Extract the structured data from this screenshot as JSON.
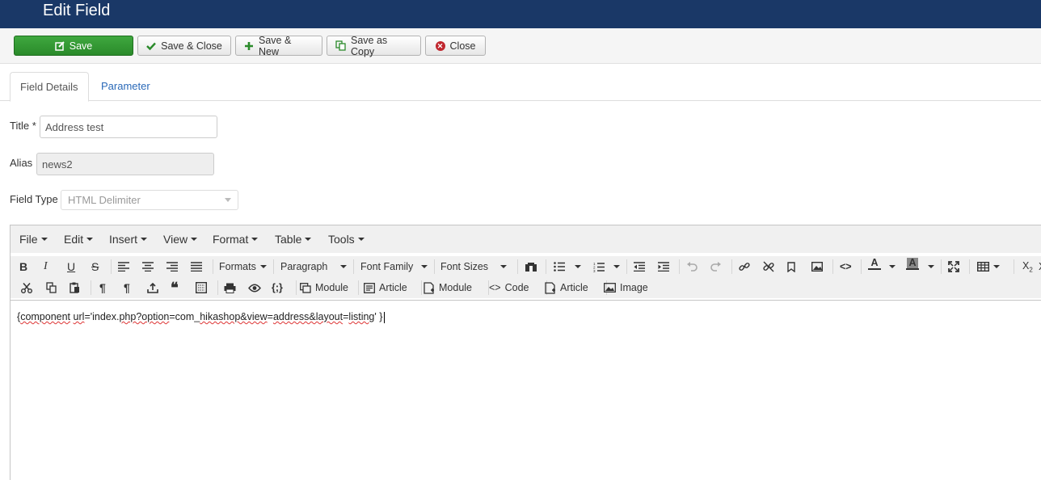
{
  "header": {
    "title": "Edit Field"
  },
  "toolbar": {
    "save": "Save",
    "save_close": "Save & Close",
    "save_new": "Save & New",
    "save_copy": "Save as Copy",
    "close": "Close"
  },
  "tabs": {
    "details": "Field Details",
    "parameter": "Parameter"
  },
  "form": {
    "title_label": "Title *",
    "title_value": "Address test",
    "alias_label": "Alias",
    "alias_value": "news2",
    "type_label": "Field Type",
    "type_value": "HTML Delimiter"
  },
  "editor": {
    "menu": [
      "File",
      "Edit",
      "Insert",
      "View",
      "Format",
      "Table",
      "Tools"
    ],
    "formats": "Formats",
    "paragraph": "Paragraph",
    "font_family": "Font Family",
    "font_sizes": "Font Sizes",
    "ext_module_1": "Module",
    "ext_article_1": "Article",
    "ext_module_2": "Module",
    "ext_code": "Code",
    "ext_article_2": "Article",
    "ext_image": "Image",
    "content": {
      "p1": "{",
      "w1": "component",
      "p2": " ",
      "w2": "url",
      "p3": "='index.",
      "w3": "php?option",
      "p4": "=com_",
      "w4": "hikashop&view",
      "p5": "=",
      "w5": "address&layout",
      "p6": "=",
      "w6": "listing",
      "p7": "' }"
    }
  }
}
